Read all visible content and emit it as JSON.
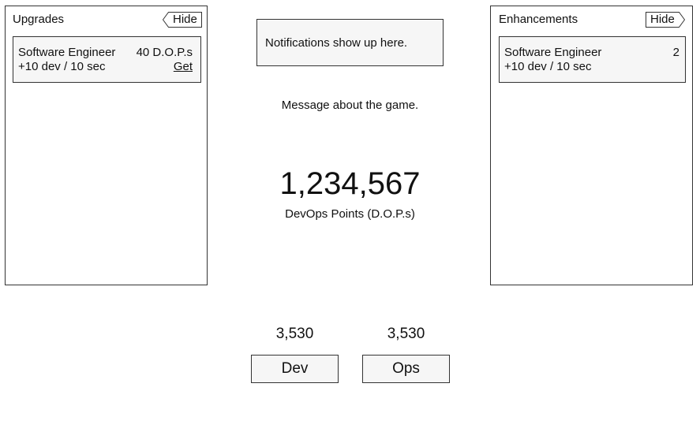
{
  "upgrades": {
    "title": "Upgrades",
    "hide_label": "Hide",
    "items": [
      {
        "name": "Software Engineer",
        "rate": "+10 dev / 10 sec",
        "cost": "40 D.O.P.s",
        "action_label": "Get"
      }
    ]
  },
  "enhancements": {
    "title": "Enhancements",
    "hide_label": "Hide",
    "items": [
      {
        "name": "Software Engineer",
        "rate": "+10 dev / 10 sec",
        "count": "2"
      }
    ]
  },
  "notification": {
    "text": "Notifications show up here."
  },
  "main": {
    "message": "Message about the game.",
    "points": "1,234,567",
    "points_label": "DevOps Points (D.O.P.s)"
  },
  "dev": {
    "count": "3,530",
    "button_label": "Dev"
  },
  "ops": {
    "count": "3,530",
    "button_label": "Ops"
  },
  "colors": {
    "border": "#333333",
    "card_background": "#f6f6f6",
    "page_background": "#ffffff"
  }
}
